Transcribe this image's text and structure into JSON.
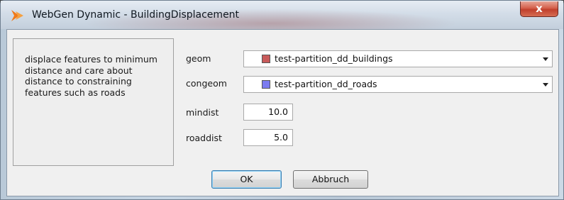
{
  "window": {
    "title": "WebGen Dynamic - BuildingDisplacement",
    "close_label": "x"
  },
  "description": "displace features to minimum distance and care about distance to constraining features such as roads",
  "params": {
    "geom": {
      "label": "geom",
      "value": "test-partition_dd_buildings",
      "swatch_color": "#c85a5a"
    },
    "congeom": {
      "label": "congeom",
      "value": "test-partition_dd_roads",
      "swatch_color": "#7b7bf0"
    },
    "mindist": {
      "label": "mindist",
      "value": "10.0"
    },
    "roaddist": {
      "label": "roaddist",
      "value": "5.0"
    }
  },
  "buttons": {
    "ok": "OK",
    "cancel": "Abbruch"
  },
  "colors": {
    "accent_orange": "#f07a1a",
    "close_red": "#c1402c"
  },
  "icons": {
    "app": "webgen-logo-icon",
    "dropdown": "chevron-down-icon"
  }
}
